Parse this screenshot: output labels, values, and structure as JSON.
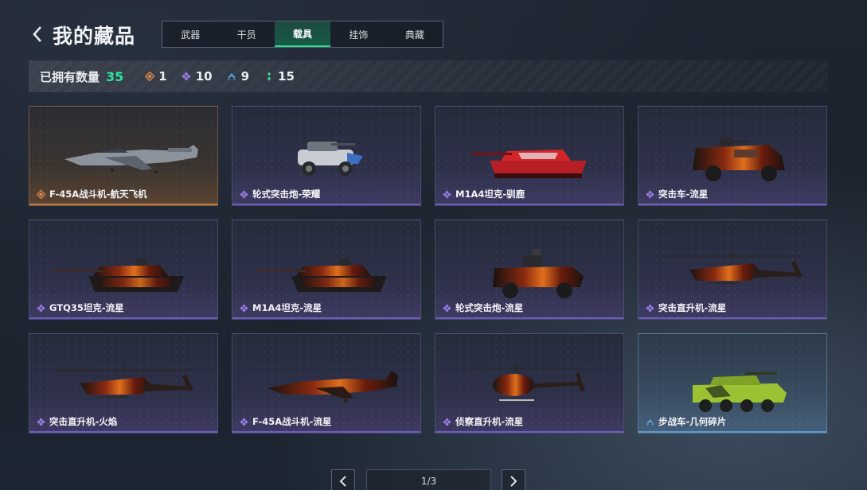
{
  "header": {
    "title": "我的藏品",
    "back_icon": "chevron-left-icon"
  },
  "tabs": [
    {
      "label": "武器",
      "active": false
    },
    {
      "label": "干员",
      "active": false
    },
    {
      "label": "载具",
      "active": true
    },
    {
      "label": "挂饰",
      "active": false
    },
    {
      "label": "典藏",
      "active": false
    }
  ],
  "summary": {
    "label": "已拥有数量",
    "total": "35",
    "total_color": "#2ee59a",
    "rarities": [
      {
        "icon": "legendary-diamond-icon",
        "color": "#d9864a",
        "count": "1"
      },
      {
        "icon": "epic-diamond-icon",
        "color": "#9a7ee8",
        "count": "10"
      },
      {
        "icon": "rare-chevron-icon",
        "color": "#5ba8e8",
        "count": "9"
      },
      {
        "icon": "uncommon-dots-icon",
        "color": "#3fdc9a",
        "count": "15"
      }
    ]
  },
  "items": [
    {
      "name": "F-45A战斗机-航天飞机",
      "rarity": "legendary",
      "vehicle": "jet"
    },
    {
      "name": "轮式突击炮-荣耀",
      "rarity": "epic",
      "vehicle": "buggy"
    },
    {
      "name": "M1A4坦克-驯鹿",
      "rarity": "epic",
      "vehicle": "tank-red"
    },
    {
      "name": "突击车-流星",
      "rarity": "epic",
      "vehicle": "armored-car"
    },
    {
      "name": "GTQ35坦克-流星",
      "rarity": "epic",
      "vehicle": "tank"
    },
    {
      "name": "M1A4坦克-流星",
      "rarity": "epic",
      "vehicle": "tank"
    },
    {
      "name": "轮式突击炮-流星",
      "rarity": "epic",
      "vehicle": "wheeled-gun"
    },
    {
      "name": "突击直升机-流星",
      "rarity": "epic",
      "vehicle": "attack-heli"
    },
    {
      "name": "突击直升机-火焰",
      "rarity": "epic",
      "vehicle": "attack-heli"
    },
    {
      "name": "F-45A战斗机-流星",
      "rarity": "epic",
      "vehicle": "jet-dark"
    },
    {
      "name": "侦察直升机-流星",
      "rarity": "epic",
      "vehicle": "scout-heli"
    },
    {
      "name": "步战车-几何碎片",
      "rarity": "rare",
      "vehicle": "ifv"
    }
  ],
  "pager": {
    "text": "1/3",
    "prev_icon": "chevron-left-icon",
    "next_icon": "chevron-right-icon"
  }
}
